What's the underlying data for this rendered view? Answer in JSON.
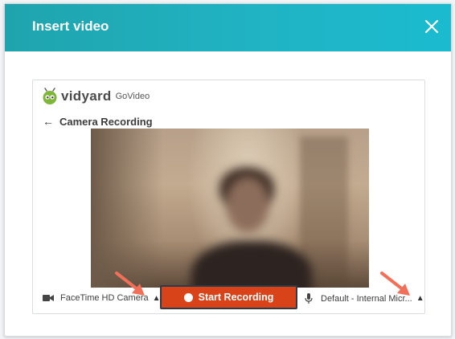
{
  "dialog": {
    "title": "Insert video",
    "close_icon": "close-icon",
    "header_color_start": "#1fa4ad",
    "header_color_end": "#1bbbcf"
  },
  "recorder": {
    "brand_name": "vidyard",
    "brand_product": "GoVideo",
    "back_label": "Camera Recording",
    "camera": {
      "icon": "video-camera-icon",
      "label": "FaceTime HD Camera"
    },
    "record_button": {
      "label": "Start Recording",
      "color": "#d9431a"
    },
    "microphone": {
      "icon": "microphone-icon",
      "label": "Default - Internal Micr..."
    }
  },
  "annotations": {
    "arrow_color": "#f0705a"
  }
}
